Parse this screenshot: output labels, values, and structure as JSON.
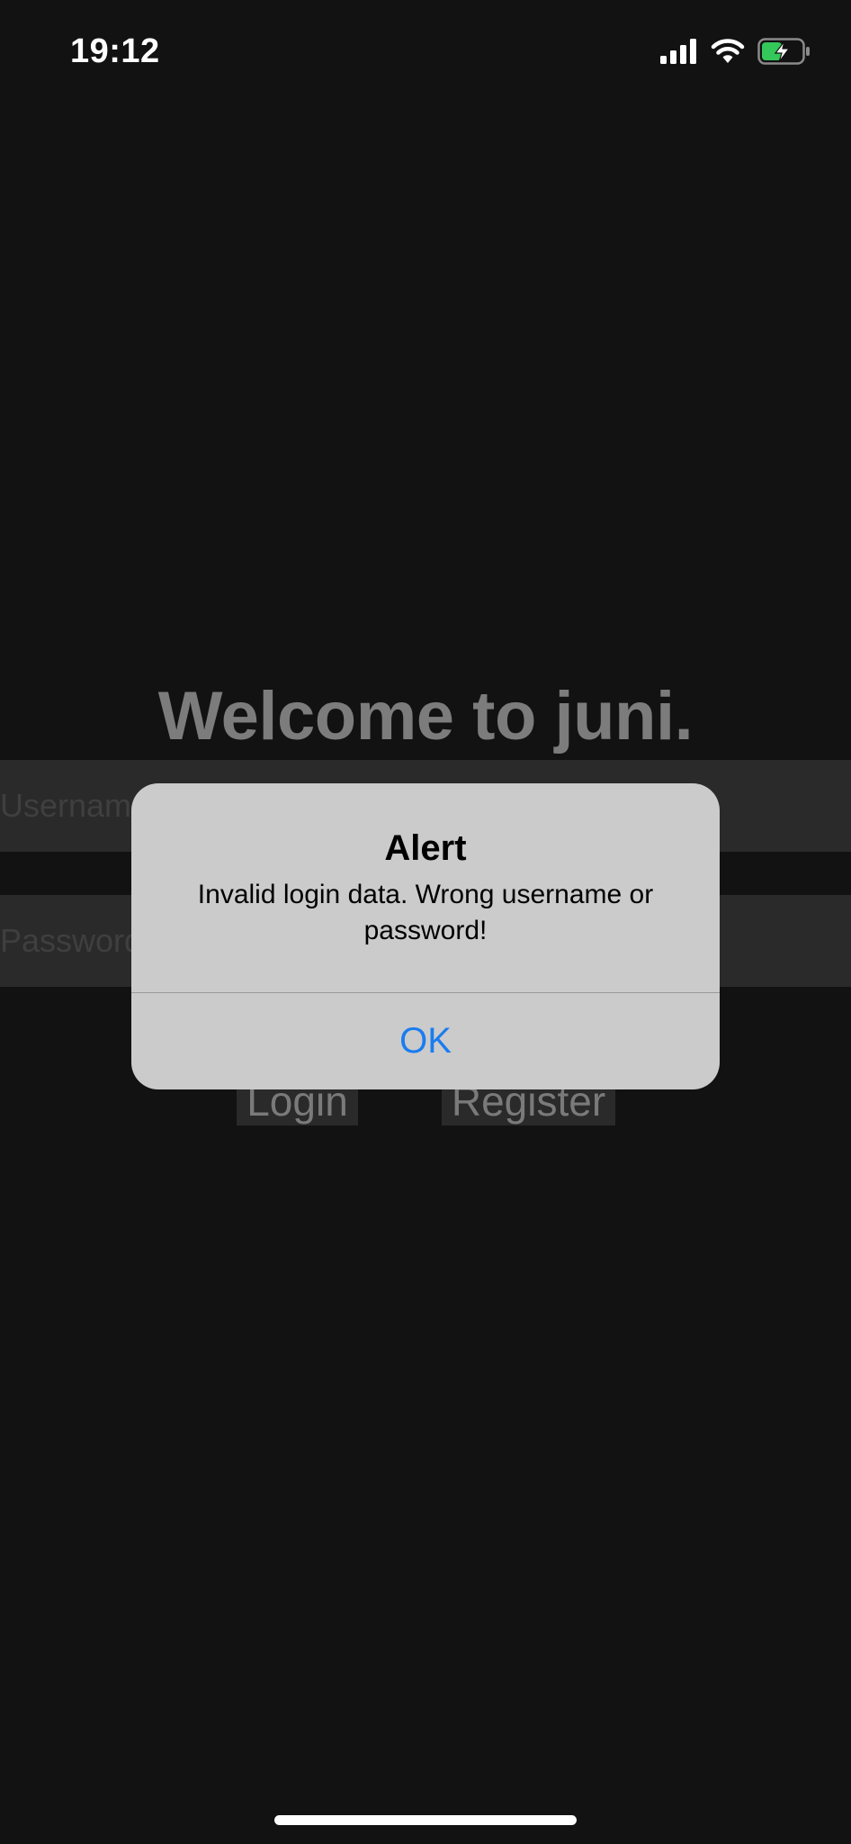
{
  "status_bar": {
    "time": "19:12",
    "icons": [
      "cellular-signal-icon",
      "wifi-icon",
      "battery-charging-icon"
    ],
    "battery_color": "#34c759"
  },
  "login": {
    "welcome_title": "Welcome to juni.",
    "username_placeholder": "Username",
    "password_placeholder": "Password",
    "login_label": "Login",
    "register_label": "Register"
  },
  "alert": {
    "title": "Alert",
    "message": "Invalid login data. Wrong username or password!",
    "ok_label": "OK",
    "accent_color": "#1a7cf0"
  }
}
